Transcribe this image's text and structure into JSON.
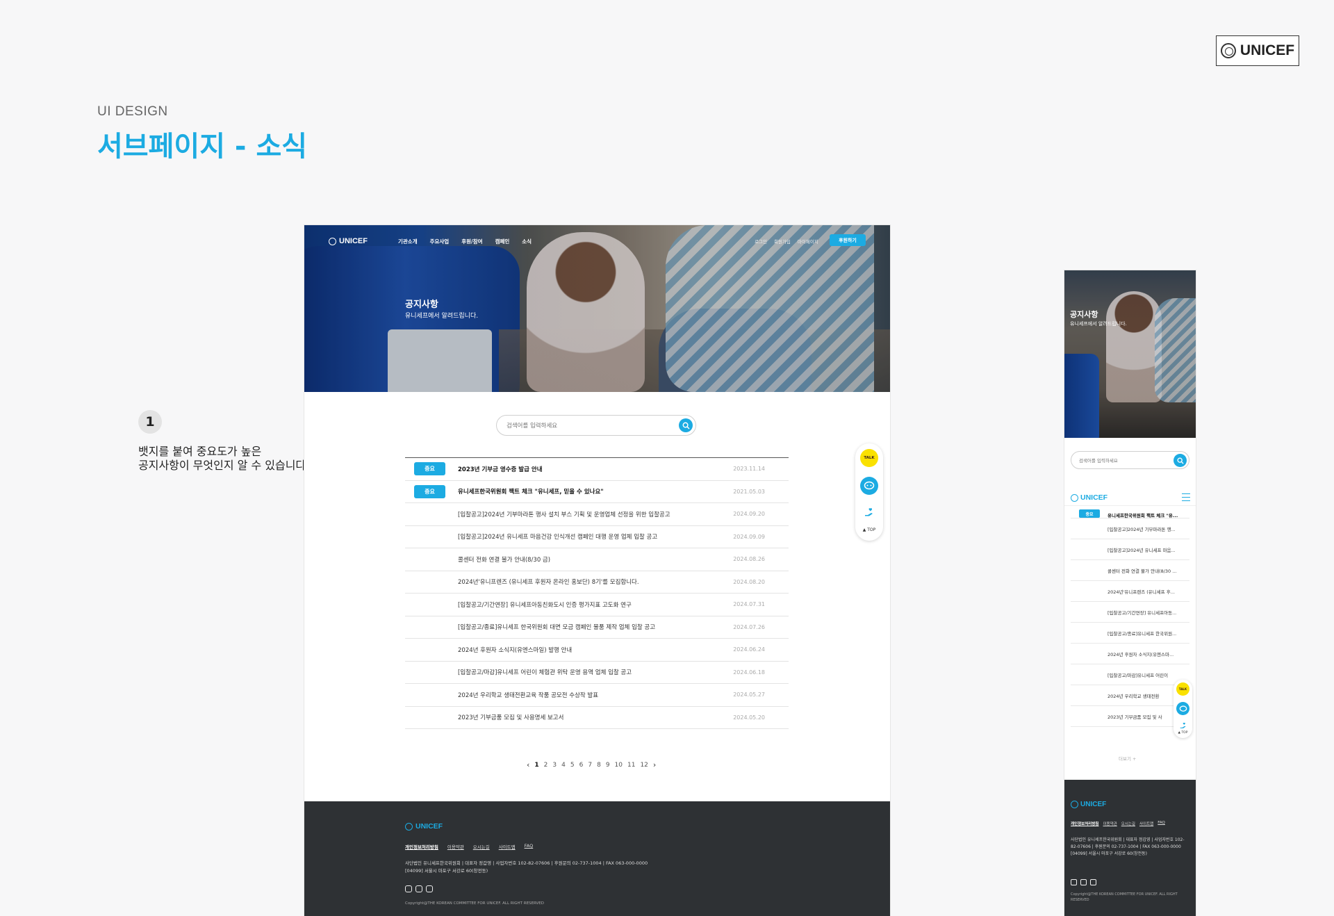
{
  "brand": "UNICEF",
  "eyebrow": "UI DESIGN",
  "page_title": "서브페이지 - 소식",
  "annotation": {
    "number": "1",
    "line1": "뱃지를 붙여 중요도가 높은",
    "line2": "공지사항이 무엇인지 알 수 있습니다."
  },
  "gnb": {
    "menu": [
      "기관소개",
      "주요사업",
      "후원/참여",
      "캠페인",
      "소식"
    ],
    "util": [
      "로그인",
      "회원가입",
      "마이페이지"
    ],
    "donate": "후원하기"
  },
  "hero": {
    "title": "공지사항",
    "subtitle": "유니세프에서 알려드립니다."
  },
  "search": {
    "placeholder": "검색어를 입력하세요"
  },
  "badge_label": "중요",
  "notices": [
    {
      "title": "2023년 기부금 영수증 발급 안내",
      "date": "2023.11.14",
      "important": true
    },
    {
      "title": "유니세프한국위원회 팩트 체크 \"유니세프, 믿을 수 있나요\"",
      "date": "2021.05.03",
      "important": true
    },
    {
      "title": "[입찰공고]2024년 기부마라톤 행사 설치 부스 기획 및 운영업체 선정을 위한 입찰공고",
      "date": "2024.09.20",
      "important": false
    },
    {
      "title": "[입찰공고]2024년 유니세프 마음건강 인식개선 캠페인 대행 운영 업체 입찰 공고",
      "date": "2024.09.09",
      "important": false
    },
    {
      "title": "콜센터 전화 연결 불가 안내(8/30 금)",
      "date": "2024.08.26",
      "important": false
    },
    {
      "title": "2024년'유니프렌즈 (유니세프 후원자 온라인 홍보단) 8기'를 모집합니다.",
      "date": "2024.08.20",
      "important": false
    },
    {
      "title": "[입찰공고/기간연장] 유니세프아동친화도시 인증 평가지표 고도화 연구",
      "date": "2024.07.31",
      "important": false
    },
    {
      "title": "[입찰공고/종료]유니세프 한국위원회 대면 모금 캠페인 물품 제작 업체 입찰 공고",
      "date": "2024.07.26",
      "important": false
    },
    {
      "title": "2024년 후원자 소식지(유엔스마일) 발행 안내",
      "date": "2024.06.24",
      "important": false
    },
    {
      "title": "[입찰공고/마감]유니세프 어린이 체험관 위탁 운영 용역 업체 입찰 공고",
      "date": "2024.06.18",
      "important": false
    },
    {
      "title": "2024년 우리학교 생태전환교육 작품 공모전 수상작 발표",
      "date": "2024.05.27",
      "important": false
    },
    {
      "title": "2023년 기부금품 모집 및 사용명세 보고서",
      "date": "2024.05.20",
      "important": false
    }
  ],
  "pagination": [
    "1",
    "2",
    "3",
    "4",
    "5",
    "6",
    "7",
    "8",
    "9",
    "10",
    "11",
    "12"
  ],
  "quick": {
    "talk": "TALK",
    "top": "TOP"
  },
  "footer": {
    "links": [
      "개인정보처리방침",
      "이용약관",
      "오시는길",
      "사이트맵",
      "FAQ"
    ],
    "info1": "사단법인 유니세프한국위원회  |  대표자 정갑영  |  사업자번호 102-82-07606  |  후원문의 02-737-1004  |  FAX 063-000-0000",
    "info2": "[04099] 서울시 마포구 서강로 60(창전동)",
    "copyright": "Copyright@THE KOREAN COMMITTEE FOR UNICEF. ALL RIGHT RESERVED"
  },
  "mobile": {
    "notices": [
      "유니세프한국위원회 팩트 체크 \"유...",
      "[입찰공고]2024년 기부마라톤 행...",
      "[입찰공고]2024년 유니세프 마음...",
      "콜센터 전화 연결 불가 안내(8/30 ...",
      "2024년'유니프렌즈 (유니세프 후...",
      "[입찰공고/기간연장] 유니세프아동...",
      "[입찰공고/종료]유니세프 한국위원...",
      "2024년 후원자 소식지(유엔스마...",
      "[입찰공고/마감]유니세프 어린이",
      "2024년 우리학교 생태전환",
      "2023년 기부금품 모집 및 사"
    ],
    "more": "더보기  +",
    "footer_info1": "사단법인 유니세프한국위원회  |  대표자 정갑영  |  사업자번호 102-82-07606  |  후원문의 02-737-1004  |  FAX 063-000-0000",
    "footer_info2": "[04099] 서울시 마포구 서강로 60(창전동)",
    "copyright": "Copyright@THE KOREAN COMMITTEE FOR UNICEF. ALL RIGHT RESERVED"
  }
}
